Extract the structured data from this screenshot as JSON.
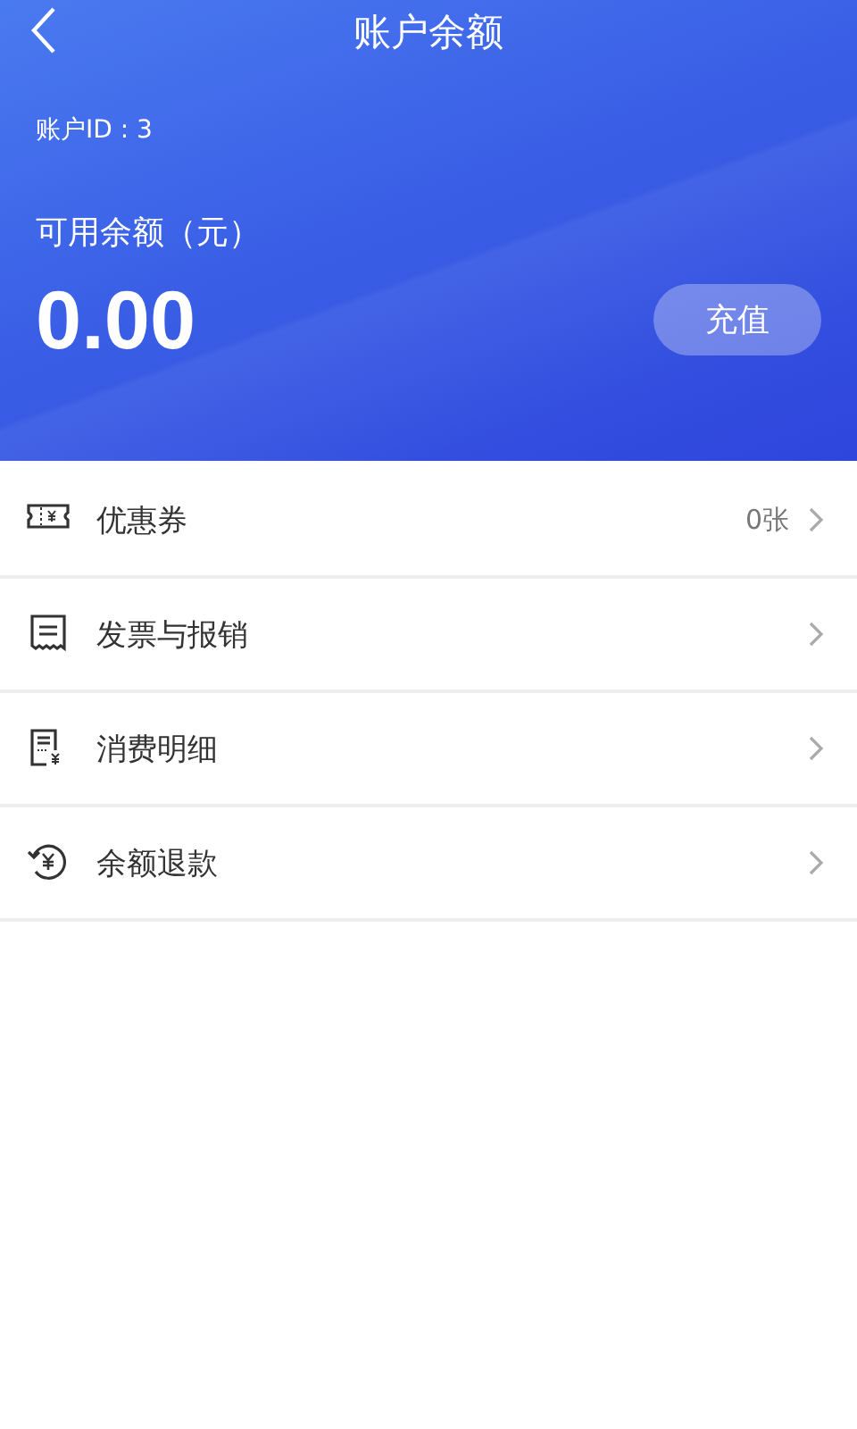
{
  "header": {
    "title": "账户余额"
  },
  "account": {
    "id_label": "账户ID : 3",
    "balance_label": "可用余额（元）",
    "balance": "0.00",
    "recharge_button": "充值"
  },
  "menu": [
    {
      "label": "优惠券",
      "value": "0张"
    },
    {
      "label": "发票与报销"
    },
    {
      "label": "消费明细"
    },
    {
      "label": "余额退款"
    }
  ]
}
